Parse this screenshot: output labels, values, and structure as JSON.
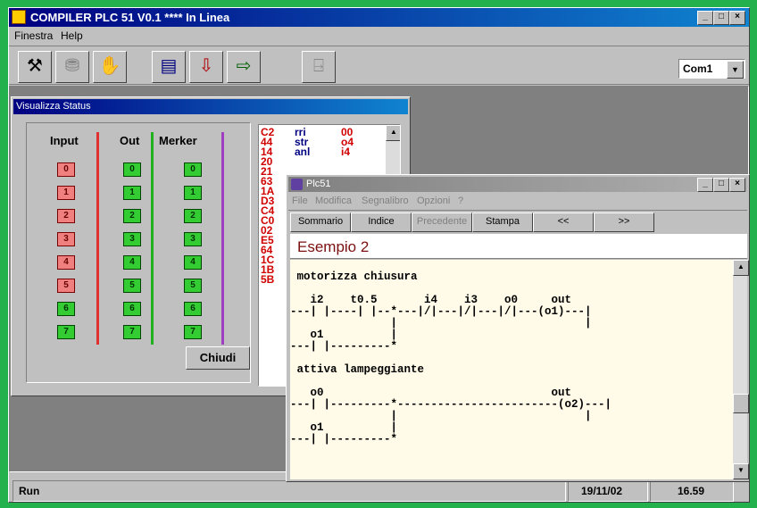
{
  "app": {
    "title": "COMPILER PLC 51 V0.1 **** In Linea",
    "window_buttons": [
      "_",
      "□",
      "×"
    ]
  },
  "menu": [
    "Finestra",
    "Help"
  ],
  "toolbar": {
    "buttons": [
      {
        "name": "tools-icon",
        "glyph": "⚒"
      },
      {
        "name": "stamp-icon",
        "glyph": "⛃"
      },
      {
        "name": "hand-icon",
        "glyph": "✋"
      },
      {
        "name": "editor-icon",
        "glyph": "▤"
      },
      {
        "name": "download-icon",
        "glyph": "⇩"
      },
      {
        "name": "upload-icon",
        "glyph": "⇨"
      },
      {
        "name": "exit-door-icon",
        "glyph": "⍈"
      }
    ],
    "port": "Com1"
  },
  "status_window": {
    "title": "Visualizza Status",
    "columns": [
      "Input",
      "Out",
      "Merker"
    ],
    "indices": [
      "0",
      "1",
      "2",
      "3",
      "4",
      "5",
      "6",
      "7"
    ],
    "input_states": [
      true,
      true,
      true,
      true,
      true,
      true,
      false,
      false
    ],
    "close_label": "Chiudi",
    "listing": {
      "codes": [
        "C2",
        "44",
        "14",
        "20",
        "21",
        "63",
        "1A",
        "D3",
        "C4",
        "C0",
        "02",
        "E5",
        "64",
        "1C",
        "1B",
        "5B"
      ],
      "ops": [
        "rri",
        "str",
        "anl"
      ],
      "args": [
        "00",
        "o4",
        "i4"
      ]
    }
  },
  "help_window": {
    "title": "Plc51",
    "menu": [
      "File",
      "Modifica",
      "Segnalibro",
      "Opzioni",
      "?"
    ],
    "buttons": [
      "Sommario",
      "Indice",
      "Precedente",
      "Stampa",
      "<<",
      ">>"
    ],
    "heading": "Esempio 2",
    "ladder_lines": [
      "",
      " motorizza chiusura",
      "",
      "   i2    t0.5       i4    i3    o0     out",
      "---| |----| |--*---|/|---|/|---|/|---(o1)---|",
      "               |                            |",
      "   o1          |",
      "---| |---------*",
      "",
      " attiva lampeggiante",
      "",
      "   o0                                  out",
      "---| |---------*------------------------(o2)---|",
      "               |                            |",
      "   o1          |",
      "---| |---------*"
    ]
  },
  "status_bar": {
    "mode": "Run",
    "date": "19/11/02",
    "time": "16.59"
  },
  "colors": {
    "background": "#22b14c",
    "input_on": "#f08080",
    "output_on": "#33cc33",
    "help_heading": "#7a1010",
    "listing_code": "#d00000",
    "listing_op": "#000080"
  }
}
